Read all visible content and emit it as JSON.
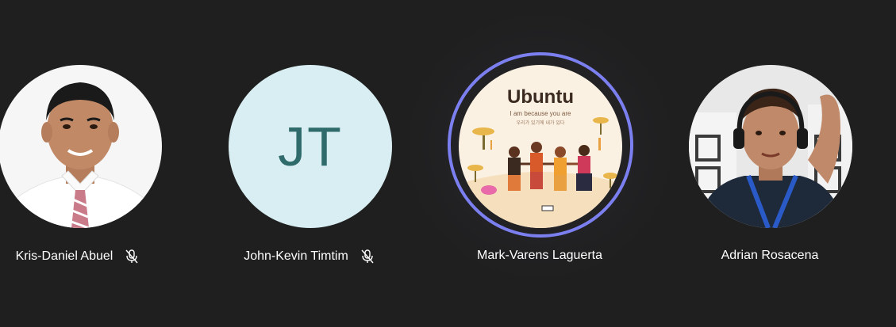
{
  "participants": [
    {
      "name": "Kris-Daniel Abuel",
      "muted": true,
      "avatar": "photo"
    },
    {
      "name": "John-Kevin Timtim",
      "initials": "JT",
      "muted": true,
      "avatar": "initials"
    },
    {
      "name": "Mark-Varens Laguerta",
      "muted": false,
      "speaking": true,
      "avatar": "illustration",
      "illustration_title": "Ubuntu",
      "illustration_subtitle": "I am because you are",
      "illustration_korean": "우리가 있기에 내가 있다"
    },
    {
      "name": "Adrian Rosacena",
      "muted": false,
      "avatar": "photo"
    }
  ],
  "colors": {
    "background": "#1f1f1f",
    "speaking_ring": "#7b7ff0",
    "initials_bg": "#d9eef2",
    "initials_fg": "#2f6b6b"
  },
  "icons": {
    "mute": "mic-off-icon"
  }
}
